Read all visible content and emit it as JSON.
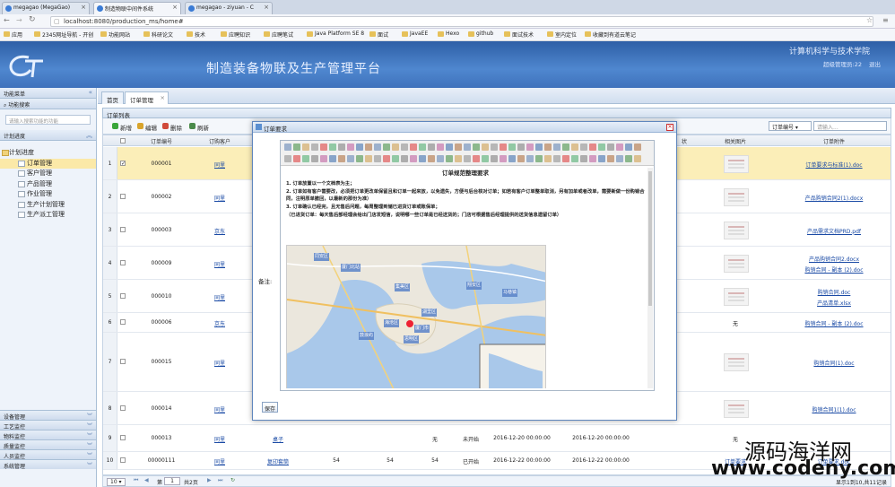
{
  "browser": {
    "tabs": [
      {
        "label": "megagao (MegaGao)",
        "active": false
      },
      {
        "label": "制造物联中间件系统",
        "active": true
      },
      {
        "label": "megagao - ziyuan - C",
        "active": false
      }
    ],
    "url": "localhost:8080/production_ms/home#",
    "bookmarks": [
      "应用",
      "2345网址导航 - 开创",
      "功能网站",
      "科研论文",
      "技术",
      "应聘知识",
      "应聘笔试",
      "Java Platform SE 8",
      "面试",
      "JavaEE",
      "Hexo",
      "github",
      "面试技术",
      "室内定位",
      "收藏到有道云笔记"
    ]
  },
  "header": {
    "system_title": "制造装备物联及生产管理平台",
    "school": "计算机科学与技术学院",
    "user": "超级管理员:22",
    "logout": "退出"
  },
  "sidebar": {
    "menu_title": "功能菜单",
    "search_title": "功能搜索",
    "search_placeholder": "请输入搜索功能的功能",
    "plan_title": "计划进度",
    "tree": [
      {
        "label": "计划进度",
        "root": true,
        "selected": false
      },
      {
        "label": "订单管理",
        "root": false,
        "selected": true
      },
      {
        "label": "客户管理",
        "root": false,
        "selected": false
      },
      {
        "label": "产品管理",
        "root": false,
        "selected": false
      },
      {
        "label": "作业管理",
        "root": false,
        "selected": false
      },
      {
        "label": "生产计划管理",
        "root": false,
        "selected": false
      },
      {
        "label": "生产派工管理",
        "root": false,
        "selected": false
      }
    ],
    "accordion": [
      "设备管理",
      "工艺监控",
      "物料监控",
      "质量监控",
      "人员监控",
      "系统管理"
    ]
  },
  "main": {
    "tabs": [
      "首页",
      "订单管理"
    ],
    "grid_title": "订单列表",
    "toolbar": {
      "add": "新增",
      "edit": "编辑",
      "delete": "删除",
      "refresh": "刷新",
      "search_field": "订单编号",
      "search_placeholder": "请输入..."
    },
    "columns": [
      "订单编号",
      "订购客户",
      "状",
      "相关图片",
      "订单附件"
    ],
    "rows": [
      {
        "n": "1",
        "id": "000001",
        "client": "同里",
        "img": true,
        "file": [
          "订单要求与标准(1).doc"
        ],
        "selected": true
      },
      {
        "n": "2",
        "id": "000002",
        "client": "同里",
        "img": true,
        "file": [
          "产品购销合同2(1).docx"
        ]
      },
      {
        "n": "3",
        "id": "000003",
        "client": "京东",
        "img": true,
        "file": [
          "产品需求文档PRD.pdf"
        ]
      },
      {
        "n": "4",
        "id": "000009",
        "client": "同里",
        "img": true,
        "file": [
          "产品购销合同2.docx",
          "购销合同 - 副本 (2).doc"
        ]
      },
      {
        "n": "5",
        "id": "000010",
        "client": "同里",
        "img": true,
        "file": [
          "购销合同.doc",
          "产品清单.xlsx"
        ]
      },
      {
        "n": "6",
        "id": "000006",
        "client": "京东",
        "img": false,
        "imgtext": "无",
        "file": [
          "购销合同 - 副本 (2).doc"
        ]
      },
      {
        "n": "7",
        "id": "000015",
        "client": "同里",
        "img": true,
        "file": [
          "购销合同(1).doc"
        ]
      },
      {
        "n": "8",
        "id": "000014",
        "client": "同里",
        "img": true,
        "file": [
          "购销合同1(1).doc"
        ]
      },
      {
        "n": "9",
        "id": "000013",
        "client": "同里",
        "product": "桌子",
        "q1": "",
        "q2": "",
        "q3": "无",
        "status": "未开始",
        "d1": "2016-12-20 00:00:00",
        "d2": "2016-12-20 00:00:00",
        "img": false,
        "imgtext": "无",
        "file": []
      },
      {
        "n": "10",
        "id": "00000111",
        "client": "同里",
        "product": "复印套筒",
        "q1": "54",
        "q2": "54",
        "q3": "54",
        "status": "已开始",
        "d1": "2016-12-22 00:00:00",
        "d2": "2016-12-22 00:00:00",
        "img": false,
        "imgtext": "订单要求",
        "file": [
          "订单要求.doc"
        ]
      }
    ],
    "pager": {
      "page_size": "10",
      "page_label": "第",
      "page": "1",
      "total": "共2页",
      "info": "显示1到10,共11记录"
    }
  },
  "dialog": {
    "title": "订单要求",
    "remark_label": "备注:",
    "save": "保存",
    "doc_title": "订单规范整理要求",
    "lines": [
      "1. 订单放置以一个文档表为主；",
      "2. 订单如有客户需要改，必须把订单更改单保留且和订单一起来放，以免遗失，方便与后台核对订单；如若有客户订单整单取消，另有加单或者改单，需要新做一份购销合同，注明原单撤回，以最新的那份为准）",
      "3. 订单确认已经完，且无售后问题，每周整理到储已进货订单或账保单；",
      "（已进货订单：每天售后部经理会给出门店发短信，说明哪一些订单是已经送货的；门店可根据售后经理提供的送货信息遗留订单）"
    ],
    "map_labels": [
      "集美区",
      "海沧区",
      "湖里区",
      "厦门市",
      "思明区",
      "翔安区",
      "马巷镇",
      "鼓浪屿",
      "厦门北站",
      "同安区"
    ]
  },
  "watermark": {
    "line1": "源码海洋网",
    "line2": "www.codeny.com"
  }
}
